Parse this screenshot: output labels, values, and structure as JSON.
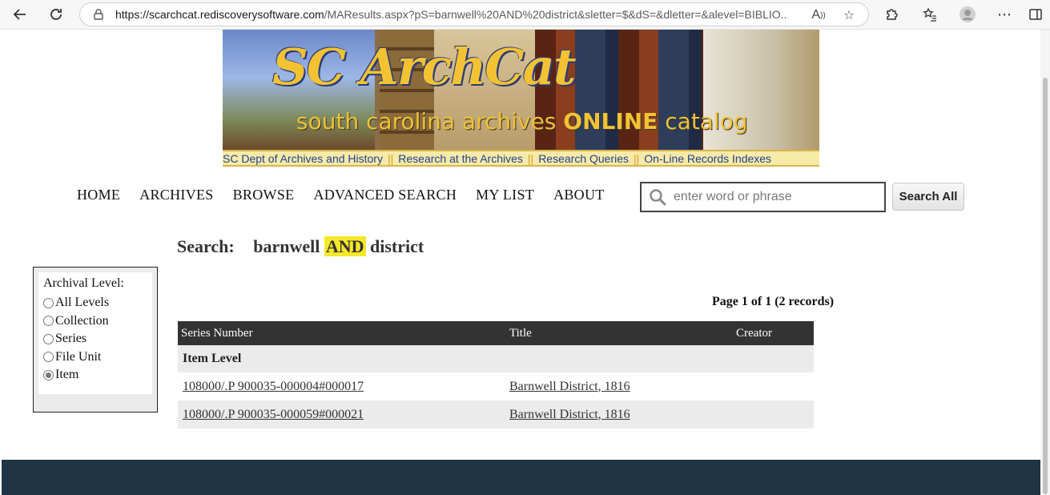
{
  "browser": {
    "url_host": "https://scarchcat.rediscoverysoftware.com",
    "url_path": "/MAResults.aspx?pS=barnwell%20AND%20district&sletter=$&dS=&dletter=&alevel=BIBLIO..."
  },
  "banner": {
    "logo_text": "SC ArchCat",
    "tagline_prefix": "south carolina archives ",
    "tagline_online": "ONLINE",
    "tagline_suffix": " catalog",
    "links": [
      "SC Dept of Archives and History",
      "Research at the Archives",
      "Research Queries",
      "On-Line Records Indexes"
    ],
    "separator": "||"
  },
  "nav": {
    "items": [
      "HOME",
      "ARCHIVES",
      "BROWSE",
      "ADVANCED SEARCH",
      "MY LIST",
      "ABOUT"
    ],
    "search_placeholder": "enter word or phrase",
    "search_button": "Search All"
  },
  "search": {
    "label": "Search:",
    "term1": "barnwell",
    "operator": "AND",
    "term2": "district"
  },
  "filter": {
    "title": "Archival Level:",
    "options": [
      "All Levels",
      "Collection",
      "Series",
      "File Unit",
      "Item"
    ],
    "selected": "Item"
  },
  "results": {
    "pager": "Page 1 of 1 (2 records)",
    "columns": [
      "Series Number",
      "Title",
      "Creator"
    ],
    "group_label": "Item Level",
    "rows": [
      {
        "series": "108000/.P 900035-000004#000017",
        "title": "Barnwell District, 1816"
      },
      {
        "series": "108000/.P 900035-000059#000021",
        "title": "Barnwell District, 1816"
      }
    ]
  },
  "colors": {
    "highlight": "#f5e82a",
    "table_header": "#333333",
    "footer": "#1f3444"
  }
}
